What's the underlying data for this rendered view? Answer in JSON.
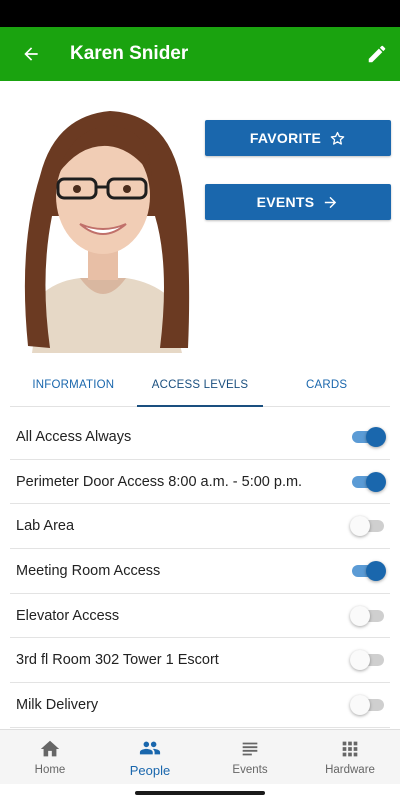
{
  "header": {
    "title": "Karen Snider",
    "back_icon": "arrow-left-icon",
    "edit_icon": "pencil-icon"
  },
  "colors": {
    "app_bar": "#1aa30f",
    "primary": "#1a67ad",
    "toggle_on_track": "#5b9bd5",
    "toggle_off_track": "#cfcfcf"
  },
  "actions": {
    "favorite_label": "FAVORITE",
    "favorite_icon": "star-outline-icon",
    "events_label": "EVENTS",
    "events_icon": "arrow-right-icon"
  },
  "tabs": [
    {
      "label": "INFORMATION",
      "active": false
    },
    {
      "label": "ACCESS LEVELS",
      "active": true
    },
    {
      "label": "CARDS",
      "active": false
    }
  ],
  "access_levels": [
    {
      "label": "All Access Always",
      "enabled": true
    },
    {
      "label": "Perimeter Door Access 8:00 a.m. - 5:00 p.m.",
      "enabled": true
    },
    {
      "label": "Lab Area",
      "enabled": false
    },
    {
      "label": "Meeting Room Access",
      "enabled": true
    },
    {
      "label": "Elevator Access",
      "enabled": false
    },
    {
      "label": "3rd fl Room 302 Tower 1 Escort",
      "enabled": false
    },
    {
      "label": "Milk Delivery",
      "enabled": false
    }
  ],
  "bottom_nav": [
    {
      "label": "Home",
      "icon": "home-icon",
      "active": false
    },
    {
      "label": "People",
      "icon": "people-icon",
      "active": true
    },
    {
      "label": "Events",
      "icon": "list-icon",
      "active": false
    },
    {
      "label": "Hardware",
      "icon": "grid-icon",
      "active": false
    }
  ]
}
